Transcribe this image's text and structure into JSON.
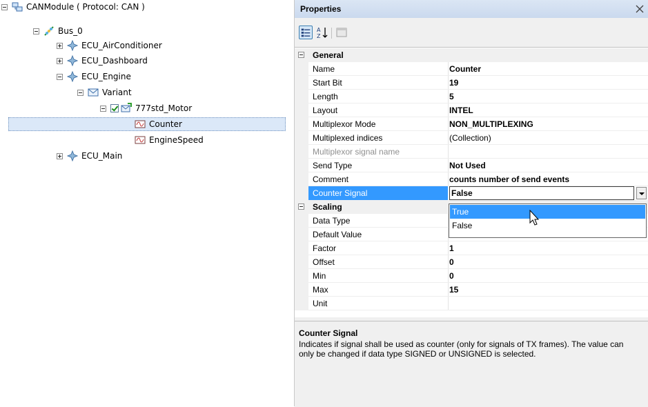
{
  "tree": {
    "items": [
      {
        "label": "CANModule ( Protocol: CAN )",
        "icon": "module-icon",
        "expander": "minus"
      },
      {
        "label": "Bus_0",
        "icon": "bus-icon",
        "expander": "minus"
      },
      {
        "label": "ECU_AirConditioner",
        "icon": "ecu-icon",
        "expander": "plus"
      },
      {
        "label": "ECU_Dashboard",
        "icon": "ecu-icon",
        "expander": "plus"
      },
      {
        "label": "ECU_Engine",
        "icon": "ecu-icon",
        "expander": "minus"
      },
      {
        "label": "Variant",
        "icon": "variant-icon",
        "expander": "minus"
      },
      {
        "label": "777std_Motor",
        "icon": "frame-icon",
        "expander": "minus",
        "checked": true
      },
      {
        "label": "Counter",
        "icon": "signal-icon",
        "selected": true
      },
      {
        "label": "EngineSpeed",
        "icon": "signal-icon"
      },
      {
        "label": "ECU_Main",
        "icon": "ecu-icon",
        "expander": "plus"
      }
    ]
  },
  "properties": {
    "title": "Properties",
    "close_icon": "close-icon",
    "toolbar": [
      "categorized-icon",
      "alphabetical-icon",
      "property-pages-icon"
    ],
    "general": {
      "label": "General",
      "rows": [
        {
          "name": "Name",
          "value": "Counter"
        },
        {
          "name": "Start Bit",
          "value": "19"
        },
        {
          "name": "Length",
          "value": "5"
        },
        {
          "name": "Layout",
          "value": "INTEL"
        },
        {
          "name": "Multiplexor Mode",
          "value": "NON_MULTIPLEXING"
        },
        {
          "name": "Multiplexed indices",
          "value": "(Collection)"
        },
        {
          "name": "Multiplexor signal name",
          "value": ""
        },
        {
          "name": "Send Type",
          "value": "Not Used"
        },
        {
          "name": "Comment",
          "value": "counts number of send events"
        },
        {
          "name": "Counter Signal",
          "value": "False"
        }
      ]
    },
    "scaling": {
      "label": "Scaling",
      "rows": [
        {
          "name": "Data Type",
          "value": ""
        },
        {
          "name": "Default Value",
          "value": "0"
        },
        {
          "name": "Factor",
          "value": "1"
        },
        {
          "name": "Offset",
          "value": "0"
        },
        {
          "name": "Min",
          "value": "0"
        },
        {
          "name": "Max",
          "value": "15"
        },
        {
          "name": "Unit",
          "value": ""
        }
      ]
    },
    "dropdown": {
      "options": [
        "True",
        "False"
      ],
      "highlighted": "True"
    },
    "description": {
      "title": "Counter Signal",
      "text": "Indicates if signal shall be used as counter (only for signals of TX frames). The value can only be changed if data type SIGNED or UNSIGNED is selected."
    }
  },
  "colors": {
    "selection": "#3399ff",
    "tree_selection": "#dbe8f8",
    "title_bar": "#cad9ee"
  }
}
